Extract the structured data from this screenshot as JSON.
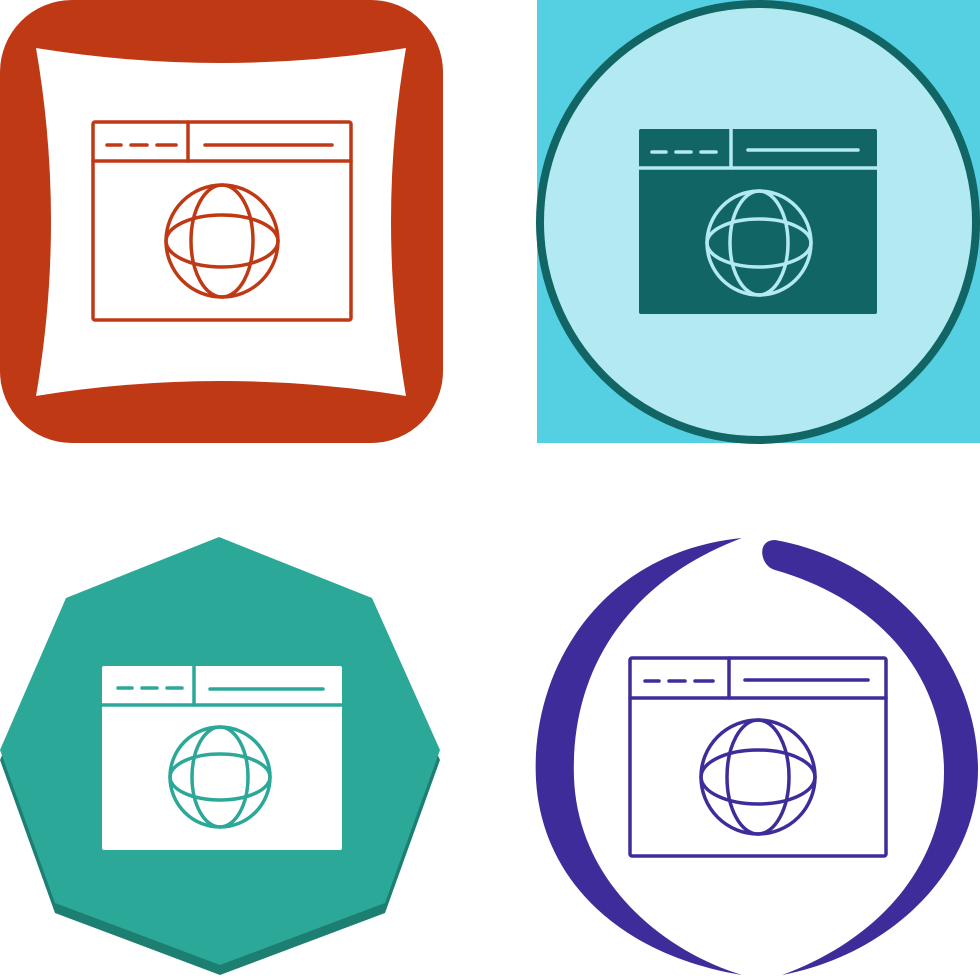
{
  "icons": [
    {
      "name": "browser-globe-icon",
      "style": "outline",
      "badge_shape": "pillow-rounded-square",
      "colors": {
        "badge": "#BF3A14",
        "fill": "#FFFFFF",
        "stroke": "#BF3A14"
      }
    },
    {
      "name": "browser-globe-icon",
      "style": "glyph",
      "badge_shape": "circle-on-square",
      "colors": {
        "background": "#55D0E3",
        "circle": "#B3EAF2",
        "ring": "#116564",
        "glyph": "#116564",
        "detail": "#B3EAF2"
      }
    },
    {
      "name": "browser-globe-icon",
      "style": "glyph",
      "badge_shape": "heptagon",
      "colors": {
        "badge": "#2BA898",
        "badge_shadow": "#1D7E72",
        "glyph": "#FFFFFF",
        "detail": "#2BA898"
      }
    },
    {
      "name": "browser-globe-icon",
      "style": "outline",
      "badge_shape": "circular-arrows",
      "colors": {
        "ring": "#3F2C9B",
        "stroke": "#3F2C9B"
      }
    }
  ]
}
